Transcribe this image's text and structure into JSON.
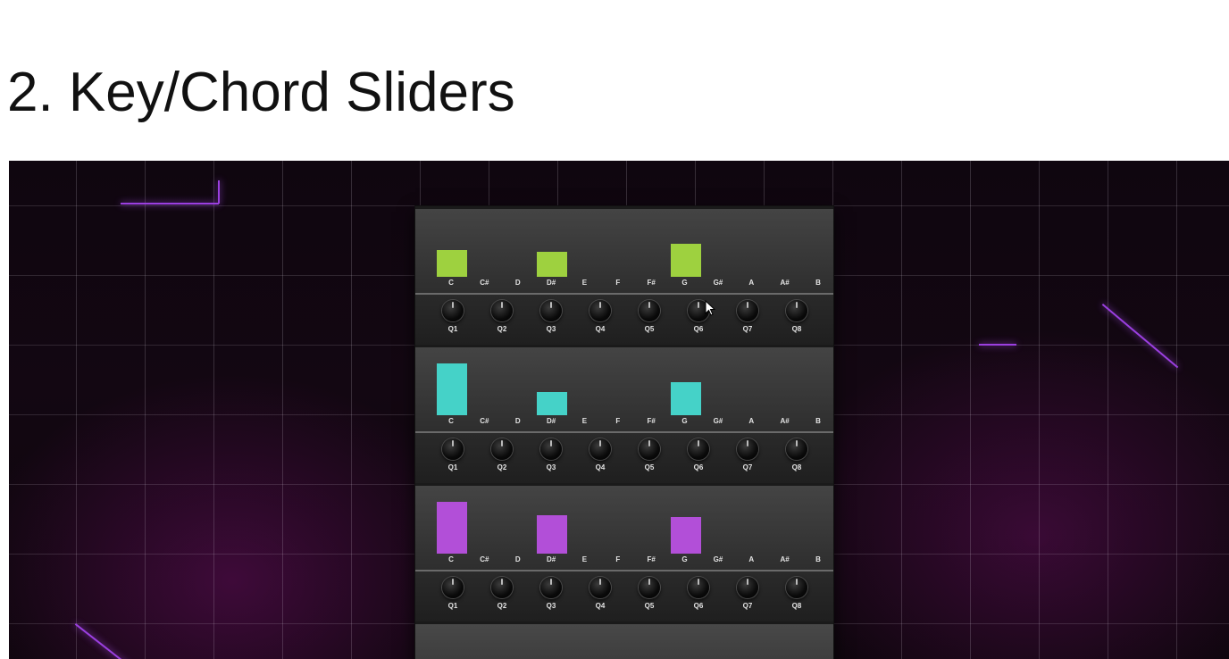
{
  "page": {
    "title": "2. Key/Chord Sliders"
  },
  "key_labels": [
    "C",
    "C#",
    "D",
    "D#",
    "E",
    "F",
    "F#",
    "G",
    "G#",
    "A",
    "A#",
    "B"
  ],
  "knob_labels": [
    "Q1",
    "Q2",
    "Q3",
    "Q4",
    "Q5",
    "Q6",
    "Q7",
    "Q8"
  ],
  "racks": [
    {
      "name": "rack-1",
      "color": "#9ed13f",
      "levels": [
        0.39,
        0,
        0,
        0.36,
        0,
        0,
        0,
        0.48,
        0,
        0,
        0,
        0
      ]
    },
    {
      "name": "rack-2",
      "color": "#45d2c8",
      "levels": [
        0.74,
        0,
        0,
        0.33,
        0,
        0,
        0,
        0.47,
        0,
        0,
        0,
        0
      ]
    },
    {
      "name": "rack-3",
      "color": "#b24fd8",
      "levels": [
        0.74,
        0,
        0,
        0.55,
        0,
        0,
        0,
        0.52,
        0,
        0,
        0,
        0
      ]
    }
  ],
  "icons": {
    "cursor": "mouse-pointer-icon",
    "knob": "knob-icon"
  },
  "colors": {
    "neon_accent": "#9b3fe0",
    "grid_background": "#120712",
    "plugin_panel": "#333333"
  }
}
